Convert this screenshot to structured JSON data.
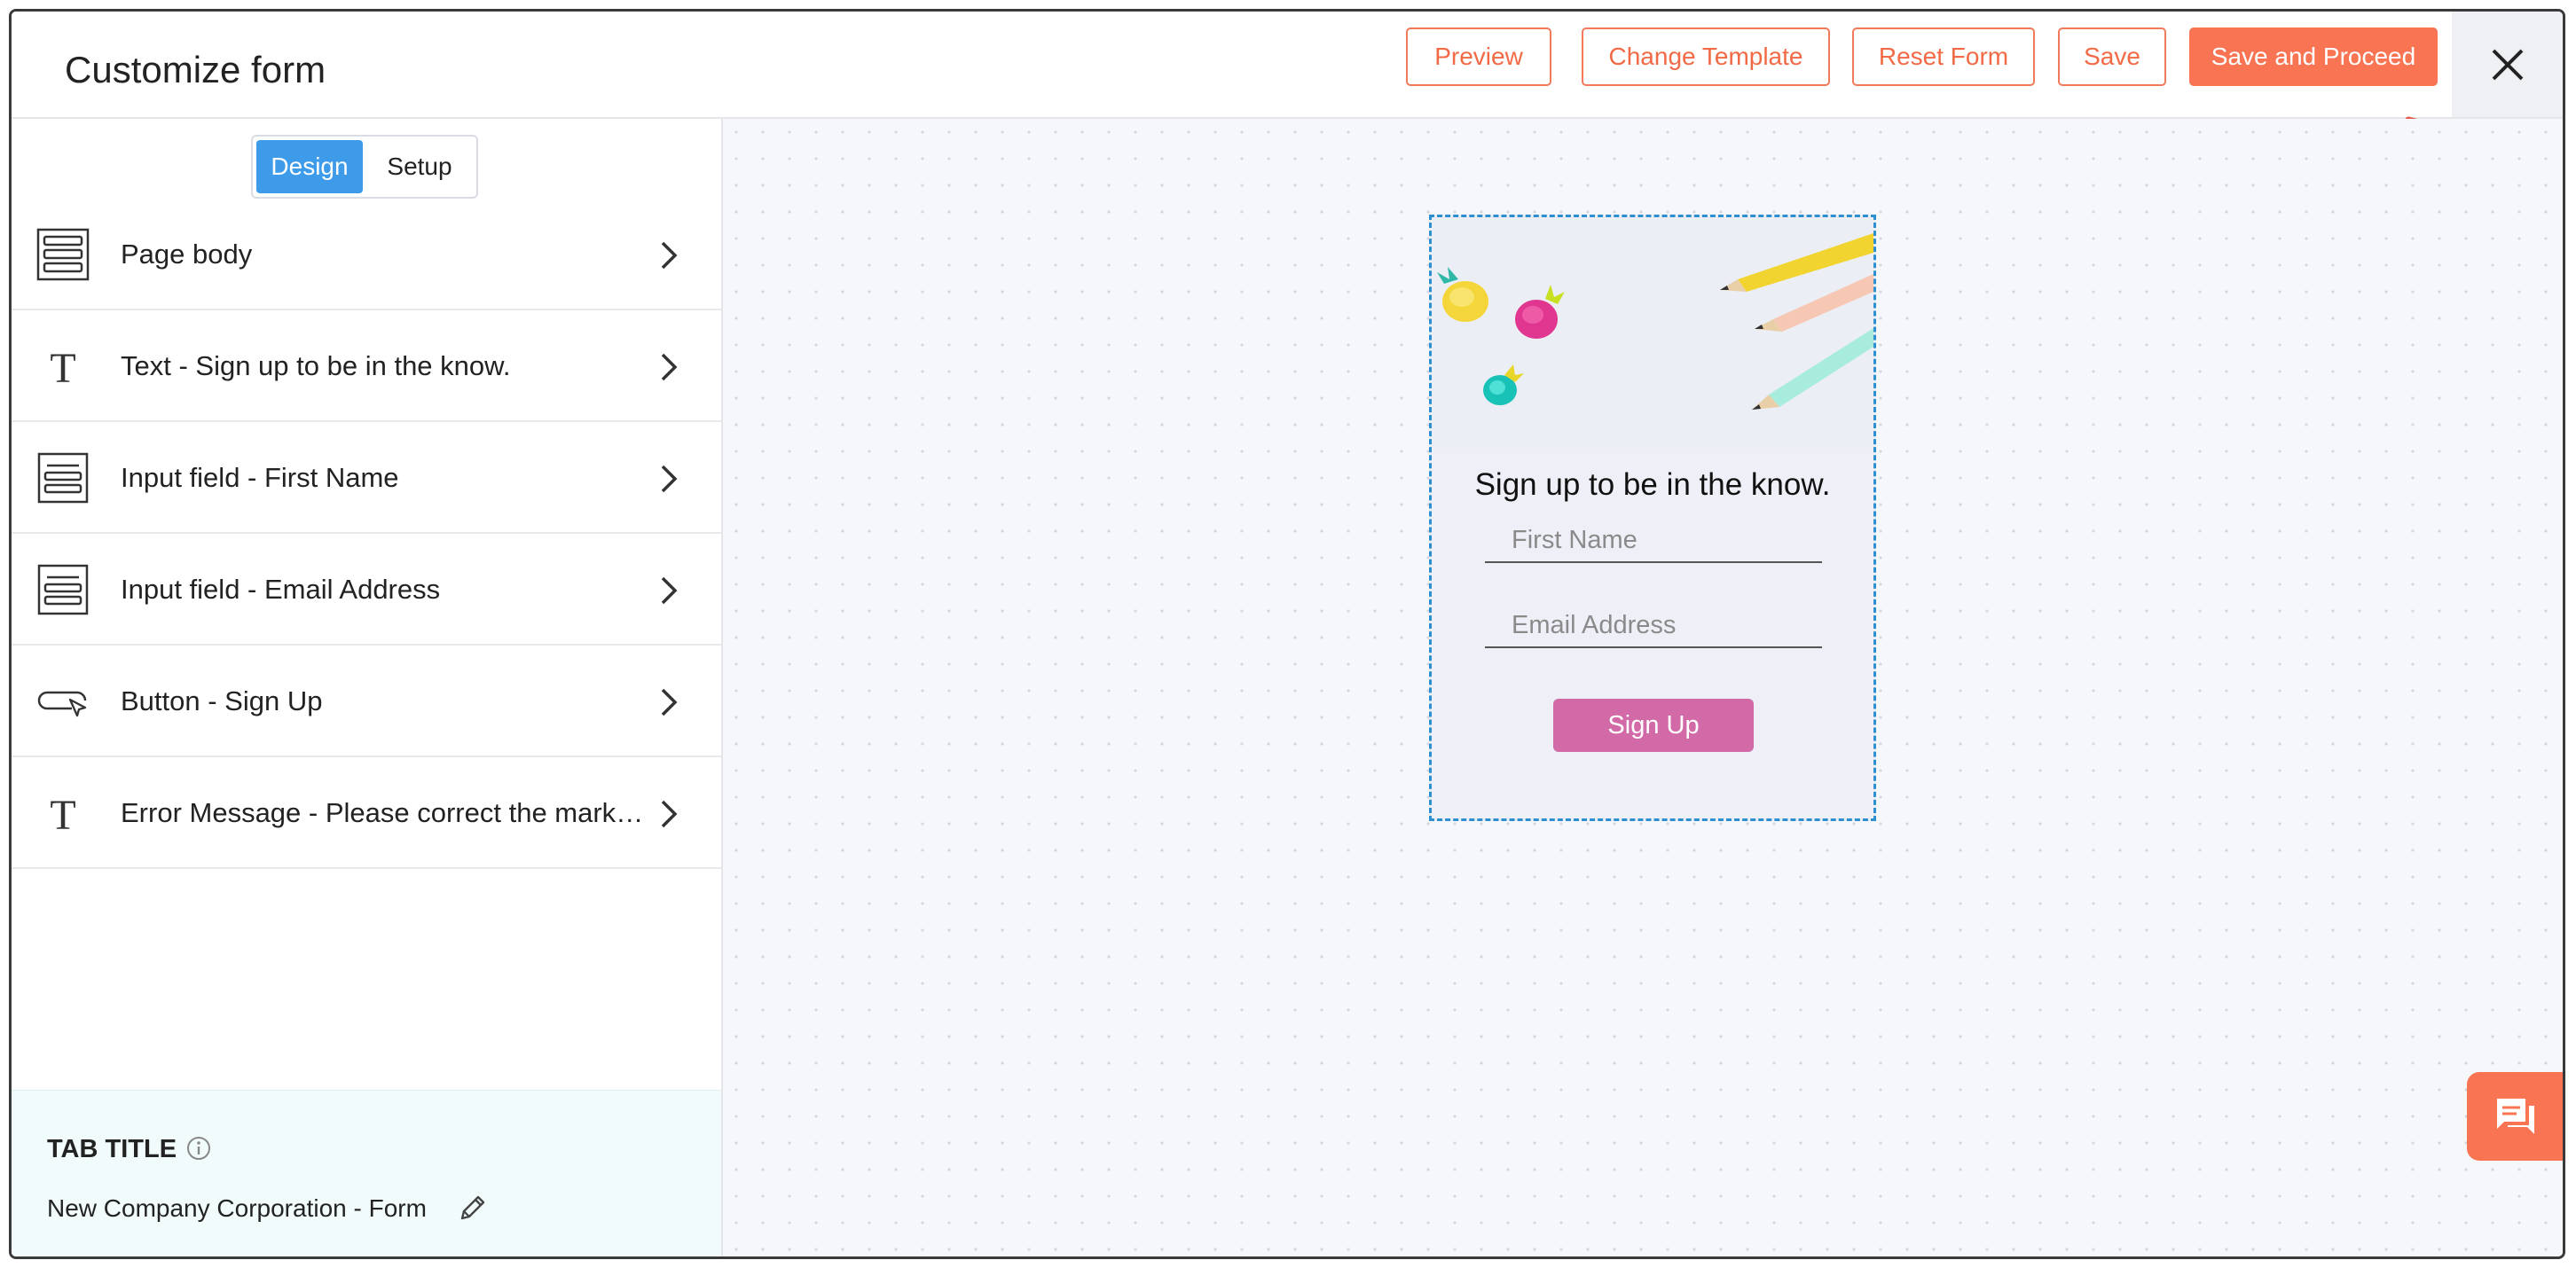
{
  "header": {
    "title": "Customize form",
    "buttons": {
      "preview": "Preview",
      "change_template": "Change Template",
      "reset_form": "Reset Form",
      "save": "Save",
      "save_and_proceed": "Save and Proceed"
    },
    "close_icon": "close-icon"
  },
  "sidebar": {
    "tabs": {
      "design": "Design",
      "setup": "Setup",
      "active": "Design"
    },
    "items": [
      {
        "label": "Page body",
        "icon": "page-body-icon"
      },
      {
        "label": "Text - Sign up to be in the know.",
        "icon": "text-icon"
      },
      {
        "label": "Input field - First Name",
        "icon": "input-field-icon"
      },
      {
        "label": "Input field - Email Address",
        "icon": "input-field-icon"
      },
      {
        "label": "Button - Sign Up",
        "icon": "button-icon"
      },
      {
        "label": "Error Message - Please correct the marked field(s) below.",
        "icon": "text-icon"
      }
    ],
    "tab_title": {
      "heading": "TAB TITLE",
      "value": "New Company Corporation - Form"
    }
  },
  "form_preview": {
    "heading": "Sign up to be in the know.",
    "first_name_placeholder": "First Name",
    "email_placeholder": "Email Address",
    "button_label": "Sign Up"
  },
  "colors": {
    "accent": "#f87453",
    "design_tab": "#3d9be9",
    "signup_button": "#d36aa8",
    "selection_border": "#2d8fd0",
    "annotation_arrow": "#e8584a"
  }
}
